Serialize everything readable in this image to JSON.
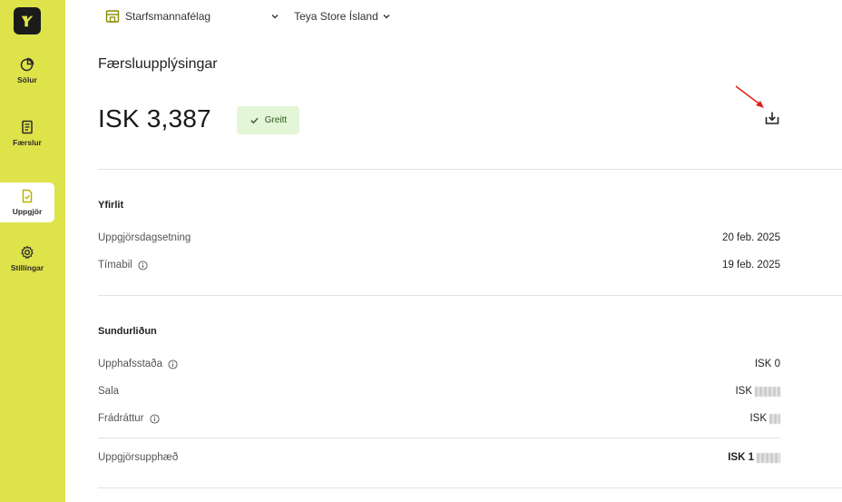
{
  "sidebar": {
    "items": [
      {
        "label": "Sölur",
        "icon": "pie-chart-icon"
      },
      {
        "label": "Færslur",
        "icon": "receipt-icon"
      },
      {
        "label": "Uppgjör",
        "icon": "settlement-doc-icon",
        "active": true
      },
      {
        "label": "Stillingar",
        "icon": "gear-icon"
      }
    ]
  },
  "topbar": {
    "merchant": "Starfsmannafélag",
    "store": "Teya Store Ísland"
  },
  "page": {
    "title": "Færsluupplýsingar",
    "amount": "ISK 3,387",
    "status": "Greitt"
  },
  "overview": {
    "title": "Yfirlit",
    "rows": [
      {
        "label": "Uppgjörsdagsetning",
        "value": "20 feb. 2025"
      },
      {
        "label": "Tímabil",
        "value": "19 feb. 2025"
      }
    ]
  },
  "breakdown": {
    "title": "Sundurliðun",
    "rows": [
      {
        "label": "Upphafsstaða",
        "value": "ISK 0"
      },
      {
        "label": "Sala",
        "value": "ISK"
      },
      {
        "label": "Frádráttur",
        "value": "ISK"
      }
    ],
    "total": {
      "label": "Uppgjörsupphæð",
      "value": "ISK 1"
    }
  },
  "colors": {
    "sidebar": "#dfe34a",
    "badge_bg": "#e3f6d8",
    "annotation_arrow": "#e02020"
  }
}
